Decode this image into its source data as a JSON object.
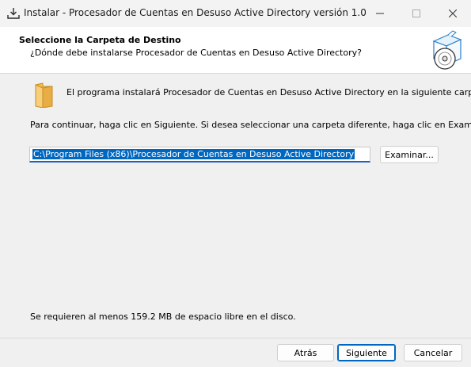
{
  "window": {
    "title": "Instalar - Procesador de Cuentas en Desuso Active Directory versión 1.0",
    "controls": {
      "minimize_icon": "minimize-icon",
      "maximize_icon": "maximize-icon",
      "close_icon": "close-icon"
    }
  },
  "header": {
    "title": "Seleccione la Carpeta de Destino",
    "subtitle": "¿Dónde debe instalarse Procesador de Cuentas en Desuso Active Directory?",
    "graphic_icon": "installer-box-cd-icon"
  },
  "content": {
    "folder_icon": "folder-icon",
    "install_message": "El programa instalará Procesador de Cuentas en Desuso Active Directory en la siguiente carpeta.",
    "continue_message": "Para continuar, haga clic en Siguiente. Si desea seleccionar una carpeta diferente, haga clic en Examinar.",
    "path_value": "C:\\Program Files (x86)\\Procesador de Cuentas en Desuso Active Directory",
    "browse_label": "Examinar...",
    "space_message": "Se requieren al menos 159.2 MB de espacio libre en el disco."
  },
  "footer": {
    "back_label": "Atrás",
    "next_label": "Siguiente",
    "cancel_label": "Cancelar"
  },
  "colors": {
    "accent": "#0067c0",
    "folder": "#f0bd5c"
  }
}
